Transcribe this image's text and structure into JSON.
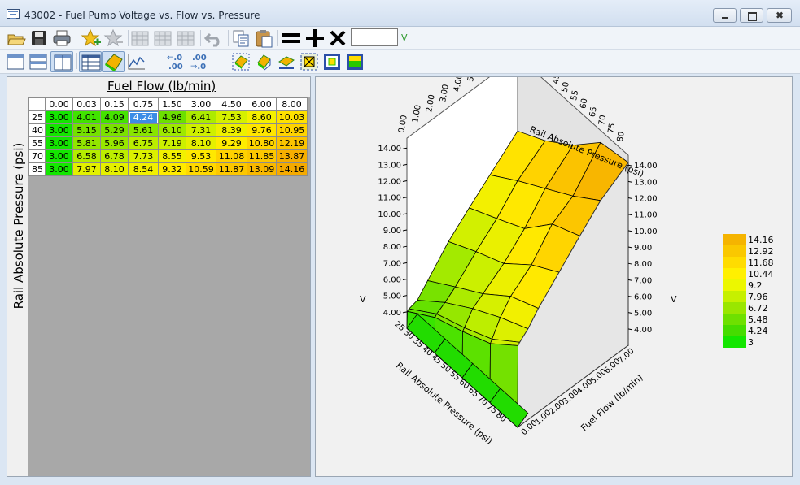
{
  "window": {
    "title": "43002 - Fuel Pump Voltage vs. Flow vs. Pressure"
  },
  "toolbar": {
    "unit_value": "",
    "unit_label": "V",
    "icons": [
      "open-folder-icon",
      "save-icon",
      "print-icon",
      "star-add-icon",
      "star-remove-icon",
      "table-edit-icon",
      "table-edit-2-icon",
      "table-edit-3-icon",
      "undo-icon",
      "copy-icon",
      "paste-icon",
      "equals-icon",
      "plus-icon",
      "multiply-icon"
    ],
    "icons2": [
      "layout-top-icon",
      "layout-split-h-icon",
      "layout-split-v-icon",
      "table-view-icon",
      "3d-view-icon",
      "line-chart-icon",
      "decimal-decrease-icon",
      "decimal-increase-icon",
      "surface-wire-icon",
      "surface-solid-icon",
      "surface-flat-icon",
      "select-box-icon",
      "frame-icon",
      "frame-fill-icon"
    ]
  },
  "table": {
    "title": "Fuel Flow (lb/min)",
    "y_label": "Rail Absolute Pressure (psi)",
    "columns": [
      "0.00",
      "0.03",
      "0.15",
      "0.75",
      "1.50",
      "3.00",
      "4.50",
      "6.00",
      "8.00"
    ],
    "rows": [
      {
        "label": "25",
        "cells": [
          "3.00",
          "4.01",
          "4.09",
          "4.24",
          "4.96",
          "6.41",
          "7.53",
          "8.60",
          "10.03"
        ]
      },
      {
        "label": "40",
        "cells": [
          "3.00",
          "5.15",
          "5.29",
          "5.61",
          "6.10",
          "7.31",
          "8.39",
          "9.76",
          "10.95"
        ]
      },
      {
        "label": "55",
        "cells": [
          "3.00",
          "5.81",
          "5.96",
          "6.75",
          "7.19",
          "8.10",
          "9.29",
          "10.80",
          "12.19"
        ]
      },
      {
        "label": "70",
        "cells": [
          "3.00",
          "6.58",
          "6.78",
          "7.73",
          "8.55",
          "9.53",
          "11.08",
          "11.85",
          "13.87"
        ]
      },
      {
        "label": "85",
        "cells": [
          "3.00",
          "7.97",
          "8.10",
          "8.54",
          "9.32",
          "10.59",
          "11.87",
          "13.09",
          "14.16"
        ]
      }
    ],
    "selected_cell": {
      "row": 0,
      "col": 3
    },
    "selection_color": "#3c8ce6"
  },
  "plot": {
    "top_axis_left_label": "Fuel Flow (lb/min)",
    "top_axis_right_label": "Rail Absolute Pressure (psi)",
    "bottom_axis_left_label": "Rail Absolute Pressure (psi)",
    "bottom_axis_right_label": "Fuel Flow (lb/min)",
    "z_label": "V",
    "z_ticks": [
      "4.00",
      "5.00",
      "6.00",
      "7.00",
      "8.00",
      "9.00",
      "10.00",
      "11.00",
      "12.00",
      "13.00",
      "14.00"
    ],
    "flow_ticks": [
      "0.00",
      "1.00",
      "2.00",
      "3.00",
      "4.00",
      "5.00",
      "6.00",
      "7.00"
    ],
    "pressure_ticks": [
      "25",
      "30",
      "35",
      "40",
      "45",
      "50",
      "55",
      "60",
      "65",
      "70",
      "75",
      "80"
    ],
    "legend": [
      "14.16",
      "12.92",
      "11.68",
      "10.44",
      "9.2",
      "7.96",
      "6.72",
      "5.48",
      "4.24",
      "3"
    ],
    "legend_colors": [
      "#f5b400",
      "#fac800",
      "#ffdc00",
      "#fff000",
      "#ecf700",
      "#c6f000",
      "#9ae600",
      "#6ee000",
      "#46dc00",
      "#14e600"
    ]
  }
}
